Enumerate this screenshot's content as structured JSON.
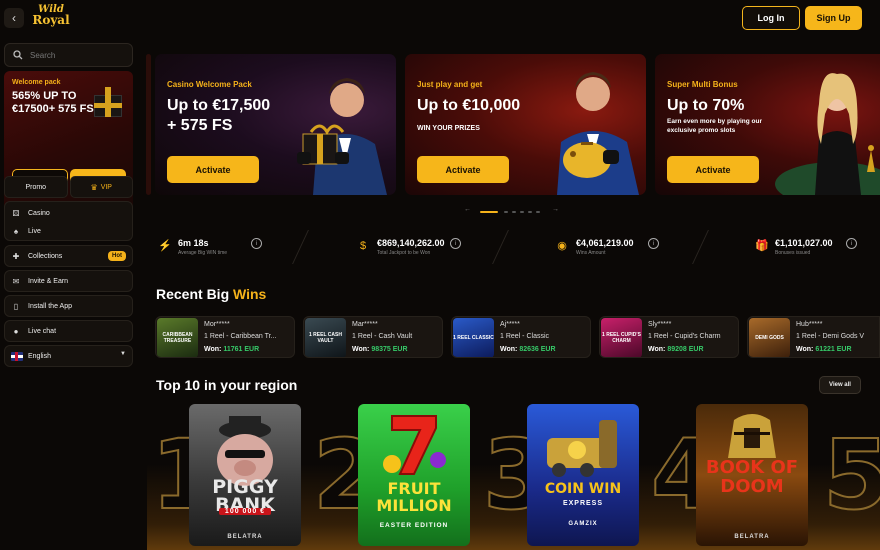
{
  "header": {
    "back_icon": "chevron-left-icon",
    "logo_line1": "Wild",
    "logo_line2": "Royal",
    "login_label": "Log In",
    "signup_label": "Sign Up"
  },
  "sidebar": {
    "search_placeholder": "Search",
    "welcome": {
      "label": "Welcome pack",
      "title": "565% UP TO €17500+ 575 FS",
      "login_label": "Log in",
      "signup_label": "Sign up"
    },
    "tabs": [
      {
        "label": "Promo"
      },
      {
        "label": "VIP",
        "icon": "crown-icon"
      }
    ],
    "groups": [
      {
        "items": [
          {
            "label": "Casino",
            "icon": "dice-icon"
          },
          {
            "label": "Live",
            "icon": "live-icon"
          }
        ]
      },
      {
        "items": [
          {
            "label": "Collections",
            "icon": "puzzle-icon",
            "badge": "Hot"
          }
        ]
      },
      {
        "items": [
          {
            "label": "Invite & Earn",
            "icon": "invite-icon"
          }
        ]
      },
      {
        "items": [
          {
            "label": "Install the App",
            "icon": "phone-icon"
          }
        ]
      },
      {
        "items": [
          {
            "label": "Live chat",
            "icon": "chat-icon"
          }
        ]
      },
      {
        "items": [
          {
            "label": "English",
            "icon": "uk-flag-icon"
          }
        ]
      }
    ]
  },
  "banners": [
    {
      "pre": "Casino Welcome Pack",
      "amount_line1": "Up to €17,500",
      "amount_line2": "+ 575 FS",
      "sub": "",
      "button": "Activate"
    },
    {
      "pre": "Just play and get",
      "amount_line1": "Up to €10,000",
      "amount_line2": "",
      "sub": "WIN YOUR PRIZES",
      "button": "Activate"
    },
    {
      "pre": "Super Multi Bonus",
      "amount_line1": "Up to 70%",
      "amount_line2": "",
      "sub": "Earn even more by playing our exclusive promo slots",
      "button": "Activate"
    }
  ],
  "carousel": {
    "pages": 6,
    "active": 1
  },
  "stats": [
    {
      "icon": "lightning-icon",
      "value": "6m 18s",
      "label": "Average Big WIN time"
    },
    {
      "icon": "coin-bag-icon",
      "value": "€869,140,262.00",
      "label": "Total Jackpot to be Won"
    },
    {
      "icon": "coins-icon",
      "value": "€4,061,219.00",
      "label": "Wins Amount"
    },
    {
      "icon": "gift-icon",
      "value": "€1,101,027.00",
      "label": "Bonuses issued"
    }
  ],
  "recent_wins": {
    "title": "Recent Big ",
    "title_accent": "Wins",
    "won_label": "Won:",
    "items": [
      {
        "user": "Mor*****",
        "game": "1 Reel - Caribbean Tr...",
        "amount": "11761 EUR",
        "thumb_text": "CARIBBEAN TREASURE",
        "color": "#2d4a1c"
      },
      {
        "user": "Mar*****",
        "game": "1 Reel - Cash Vault",
        "amount": "98375 EUR",
        "thumb_text": "1 REEL CASH VAULT",
        "color": "#1c2a30"
      },
      {
        "user": "Aj*****",
        "game": "1 Reel - Classic",
        "amount": "82636 EUR",
        "thumb_text": "1 REEL CLASSIC",
        "color": "#12307a"
      },
      {
        "user": "Sly*****",
        "game": "1 Reel - Cupid's Charm",
        "amount": "89208 EUR",
        "thumb_text": "1 REEL CUPID'S CHARM",
        "color": "#6a1044"
      },
      {
        "user": "Hub*****",
        "game": "1 Reel - Demi Gods V",
        "amount": "61221 EUR",
        "thumb_text": "DEMI GODS",
        "color": "#5a3a1a"
      }
    ]
  },
  "top10": {
    "title": "Top 10 in your region",
    "view_all": "View all",
    "ranks": [
      "1",
      "2",
      "3",
      "4",
      "5"
    ],
    "games": [
      {
        "title": "PIGGY BANK",
        "badge": "100 000 €",
        "provider": "BELATRA"
      },
      {
        "title": "FRUIT MILLION",
        "badge": "EASTER EDITION",
        "provider": ""
      },
      {
        "title": "COIN WIN",
        "badge": "EXPRESS",
        "provider": "GAMZIX"
      },
      {
        "title": "BOOK OF DOOM",
        "badge": "",
        "provider": "BELATRA"
      }
    ]
  },
  "colors": {
    "accent": "#f6b61a",
    "win_green": "#36c868",
    "background": "#0b0806"
  }
}
